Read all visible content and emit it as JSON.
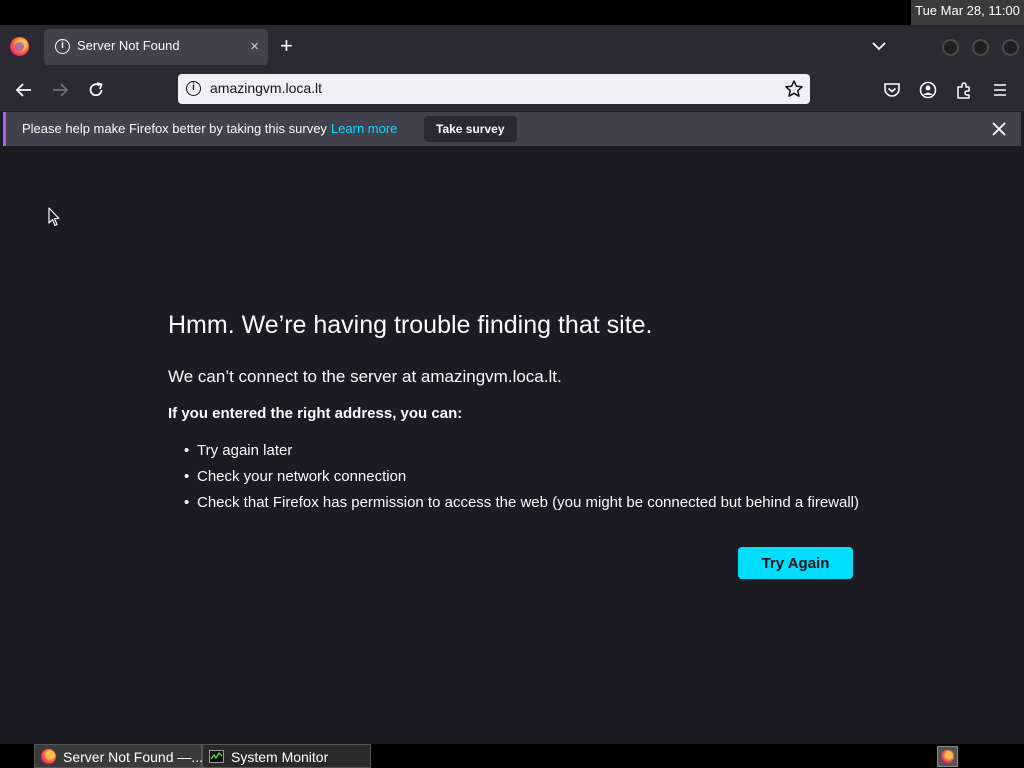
{
  "system": {
    "clock": "Tue Mar 28, 11:00"
  },
  "browser": {
    "tab": {
      "title": "Server Not Found",
      "close": "×"
    },
    "new_tab": "+",
    "url": "amazingvm.loca.lt"
  },
  "notification": {
    "message": "Please help make Firefox better by taking this survey",
    "link": "Learn more",
    "button": "Take survey"
  },
  "error_page": {
    "title": "Hmm. We’re having trouble finding that site.",
    "description": "We can’t connect to the server at amazingvm.loca.lt.",
    "subtitle": "If you entered the right address, you can:",
    "suggestions": [
      "Try again later",
      "Check your network connection",
      "Check that Firefox has permission to access the web (you might be connected but behind a firewall)"
    ],
    "button": "Try Again"
  },
  "taskbar": {
    "items": [
      {
        "label": "Server Not Found —..."
      },
      {
        "label": "System Monitor"
      }
    ]
  },
  "colors": {
    "accent": "#00ddff",
    "background": "#1c1b22",
    "toolbar": "#2b2a33"
  }
}
